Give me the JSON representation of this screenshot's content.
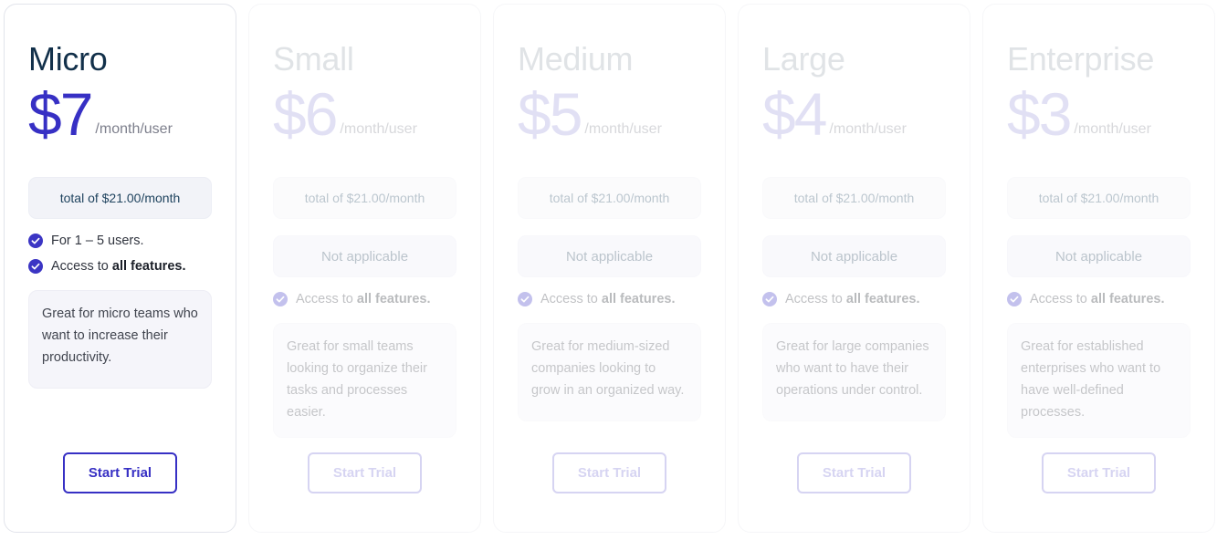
{
  "common": {
    "price_period": "/month/user",
    "total_label": "total of $21.00/month",
    "not_applicable_label": "Not applicable",
    "cta_label": "Start Trial",
    "access_feature_prefix": "Access to ",
    "access_feature_strong": "all features.",
    "check_icon": "check-circle-icon",
    "accent_color": "#3730c4",
    "heading_color": "#12304a",
    "badge_bg": "#f2f3f8",
    "na_badge_bg": "#eeeef8"
  },
  "plans": [
    {
      "name": "Micro",
      "price": "$7",
      "active": true,
      "users_feature": "For 1 – 5 users.",
      "description": "Great for micro teams who want to increase their productivity."
    },
    {
      "name": "Small",
      "price": "$6",
      "active": false,
      "users_feature": "",
      "description": "Great for small teams looking to organize their tasks and processes easier."
    },
    {
      "name": "Medium",
      "price": "$5",
      "active": false,
      "users_feature": "",
      "description": "Great for medium-sized companies looking to grow in an organized way."
    },
    {
      "name": "Large",
      "price": "$4",
      "active": false,
      "users_feature": "",
      "description": "Great for large companies who want to have their operations under control."
    },
    {
      "name": "Enterprise",
      "price": "$3",
      "active": false,
      "users_feature": "",
      "description": "Great for established enterprises who want to have well-defined processes."
    }
  ]
}
